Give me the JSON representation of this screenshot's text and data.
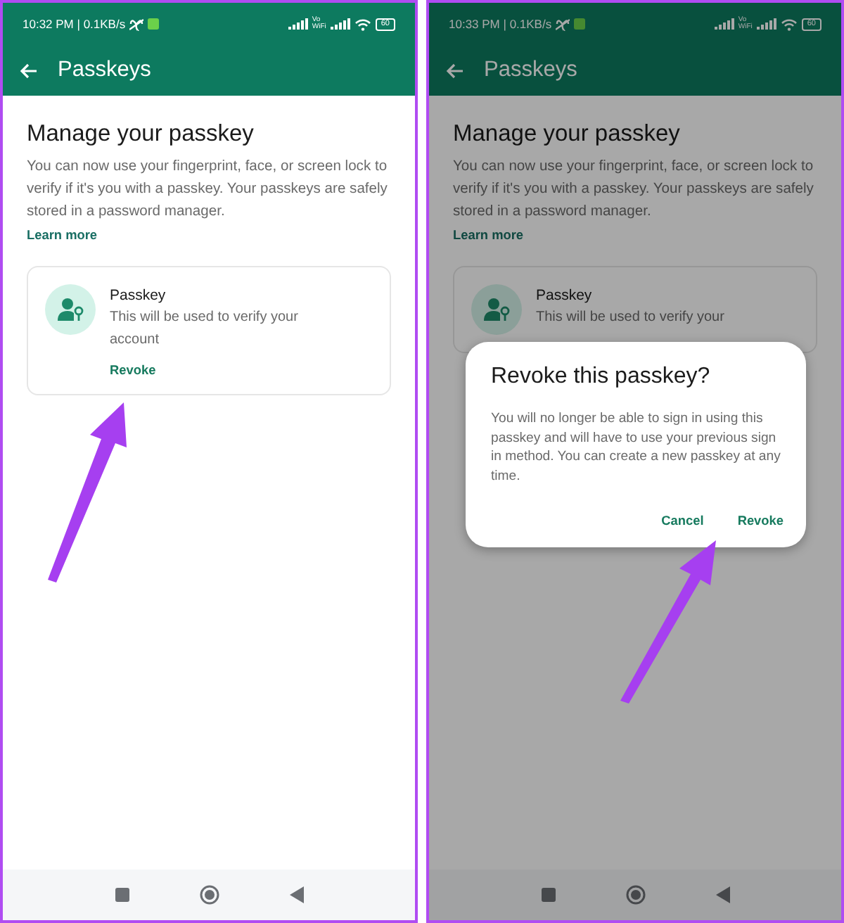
{
  "screens": [
    {
      "dimmed": false,
      "status_bar": {
        "time": "10:32 PM | 0.1KB/s",
        "wifi_calling": "Vo WiFi",
        "battery": "60"
      },
      "app_bar": {
        "title": "Passkeys"
      },
      "heading": "Manage your passkey",
      "description": "You can now use your fingerprint, face, or screen lock to verify if it's you with a passkey. Your passkeys are safely stored in a password manager.",
      "link": "Learn more",
      "passkey_card": {
        "title": "Passkey",
        "subtitle": "This will be used to verify your account",
        "action": "Revoke"
      }
    },
    {
      "dimmed": true,
      "status_bar": {
        "time": "10:33 PM | 0.1KB/s",
        "wifi_calling": "Vo WiFi",
        "battery": "60"
      },
      "app_bar": {
        "title": "Passkeys"
      },
      "heading": "Manage your passkey",
      "description": "You can now use your fingerprint, face, or screen lock to verify if it's you with a passkey. Your passkeys are safely stored in a password manager.",
      "link": "Learn more",
      "passkey_card": {
        "title": "Passkey",
        "subtitle": "This will be used to verify your"
      },
      "dialog": {
        "title": "Revoke this passkey?",
        "message": "You will no longer be able to sign in using this passkey and will have to use your previous sign in method. You can create a new passkey at any time.",
        "buttons": [
          "Cancel",
          "Revoke"
        ]
      }
    }
  ]
}
